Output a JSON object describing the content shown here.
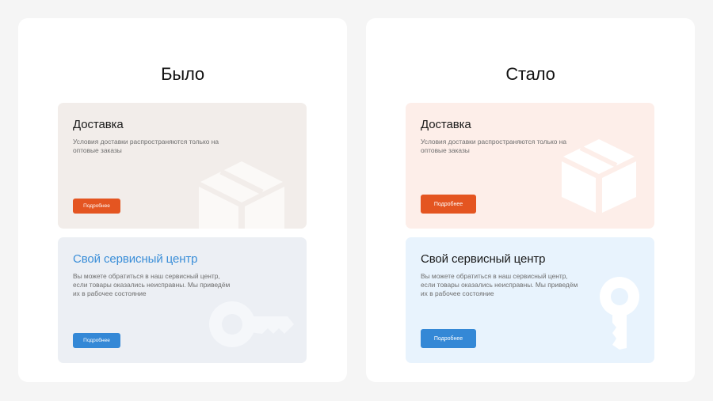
{
  "before": {
    "title": "Было",
    "delivery": {
      "title": "Доставка",
      "text": "Условия доставки распространяются только на оптовые заказы",
      "button": "Подробнее"
    },
    "service": {
      "title": "Свой сервисный центр",
      "text": "Вы можете обратиться в наш сервисный центр, если товары оказались неисправны. Мы приведём их в рабочее состояние",
      "button": "Подробнее"
    }
  },
  "after": {
    "title": "Стало",
    "delivery": {
      "title": "Доставка",
      "text": "Условия доставки распространяются только на оптовые заказы",
      "button": "Подробнее"
    },
    "service": {
      "title": "Свой сервисный центр",
      "text": "Вы можете обратиться в наш сервисный центр, если товары оказались неисправны. Мы приведём их в рабочее состояние",
      "button": "Подробнее"
    }
  },
  "icons": {
    "delivery": "box-icon",
    "service": "key-icon"
  },
  "colors": {
    "accent_orange": "#e45521",
    "accent_blue": "#3488d6",
    "before_delivery_bg": "#f2edea",
    "before_service_bg": "#eceff4",
    "after_delivery_bg": "#fdeee9",
    "after_service_bg": "#e8f3fd"
  }
}
